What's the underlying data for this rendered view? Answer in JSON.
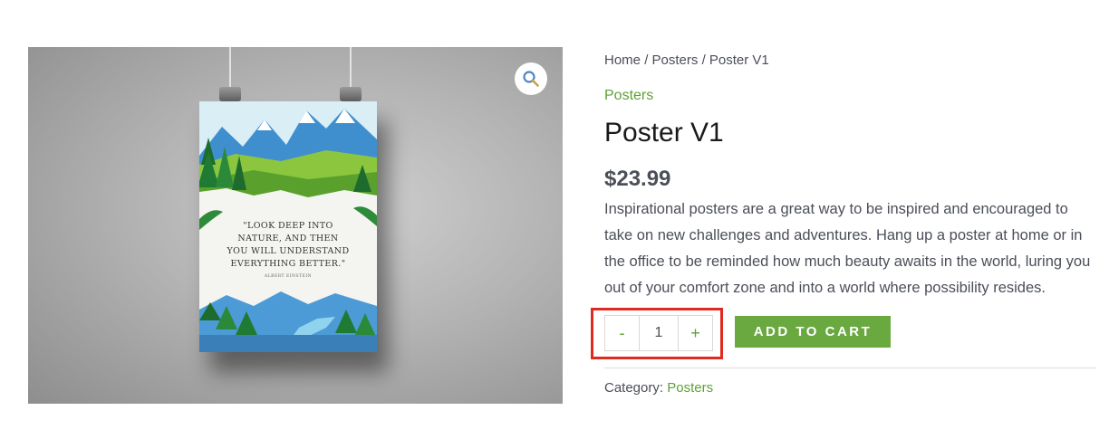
{
  "breadcrumb": {
    "home": "Home",
    "sep1": "/",
    "category": "Posters",
    "sep2": "/",
    "current": "Poster V1"
  },
  "product": {
    "category_link": "Posters",
    "title": "Poster V1",
    "price": "$23.99",
    "description": "Inspirational posters are a great way to be inspired and encouraged to take on new challenges and adventures. Hang up a poster at home or in the office to be reminded how much beauty awaits in the world, luring you out of your comfort zone and into a world where possibility resides.",
    "image": {
      "quote_line1": "\"LOOK DEEP INTO",
      "quote_line2": "NATURE, AND THEN",
      "quote_line3": "YOU WILL UNDERSTAND",
      "quote_line4": "EVERYTHING BETTER.\"",
      "author": "ALBERT EINSTEIN"
    }
  },
  "quantity": {
    "minus_label": "-",
    "value": "1",
    "plus_label": "+"
  },
  "add_to_cart_label": "ADD TO CART",
  "meta": {
    "category_label": "Category:",
    "category_value": "Posters"
  },
  "icons": {
    "zoom": "magnifier-icon"
  },
  "colors": {
    "accent": "#5ea135",
    "button": "#6aa840",
    "highlight": "#e12a1f"
  }
}
